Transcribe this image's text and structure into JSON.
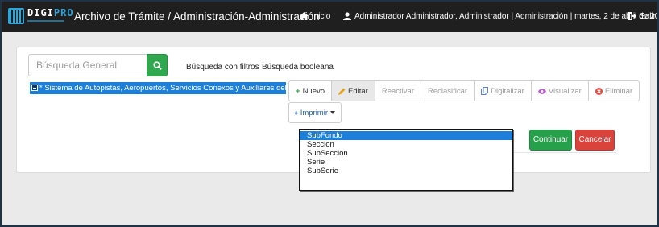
{
  "header": {
    "logo_text_a": "DIGI",
    "logo_text_b": "PRO",
    "title": "Archivo de Trámite / Administración-Administración",
    "home_label": "Inicio",
    "user_info": "Administrador Administrador, Administrador | Administración | martes, 2 de abril de 2019",
    "exit_label": "Salir"
  },
  "search": {
    "placeholder": "Búsqueda General",
    "value": ""
  },
  "links": {
    "filtros": "Búsqueda con filtros",
    "booleana": "Búsqueda booleana"
  },
  "tree": {
    "node_label": "* Sistema de Autopistas, Aeropuertos, Servicios Conexos y Auxiliares del Esta"
  },
  "toolbar": {
    "items": [
      {
        "label": "Nuevo",
        "icon": "plus-icon",
        "color": "#2f9e44",
        "state": "enabled"
      },
      {
        "label": "Editar",
        "icon": "pencil-icon",
        "color": "#e6a117",
        "state": "active"
      },
      {
        "label": "Reactivar",
        "icon": "",
        "color": "",
        "state": "disabled"
      },
      {
        "label": "Reclasificar",
        "icon": "",
        "color": "",
        "state": "disabled"
      },
      {
        "label": "Digitalizar",
        "icon": "copy-icon",
        "color": "#5a7fd6",
        "state": "disabled"
      },
      {
        "label": "Visualizar",
        "icon": "eye-icon",
        "color": "#b05fc7",
        "state": "disabled"
      },
      {
        "label": "Eliminar",
        "icon": "remove-icon",
        "color": "#e24b3f",
        "state": "disabled"
      }
    ],
    "imprimir_label": "Imprimir"
  },
  "listbox": {
    "options": [
      "SubFondo",
      "Seccion",
      "SubSección",
      "Serie",
      "SubSerie"
    ],
    "selected": "SubFondo"
  },
  "actions": {
    "continuar": "Continuar",
    "cancelar": "Cancelar"
  },
  "colors": {
    "navbar": "#1f1f1f",
    "selection": "#1e7fd8",
    "success": "#27a04b",
    "danger": "#d9433b"
  }
}
